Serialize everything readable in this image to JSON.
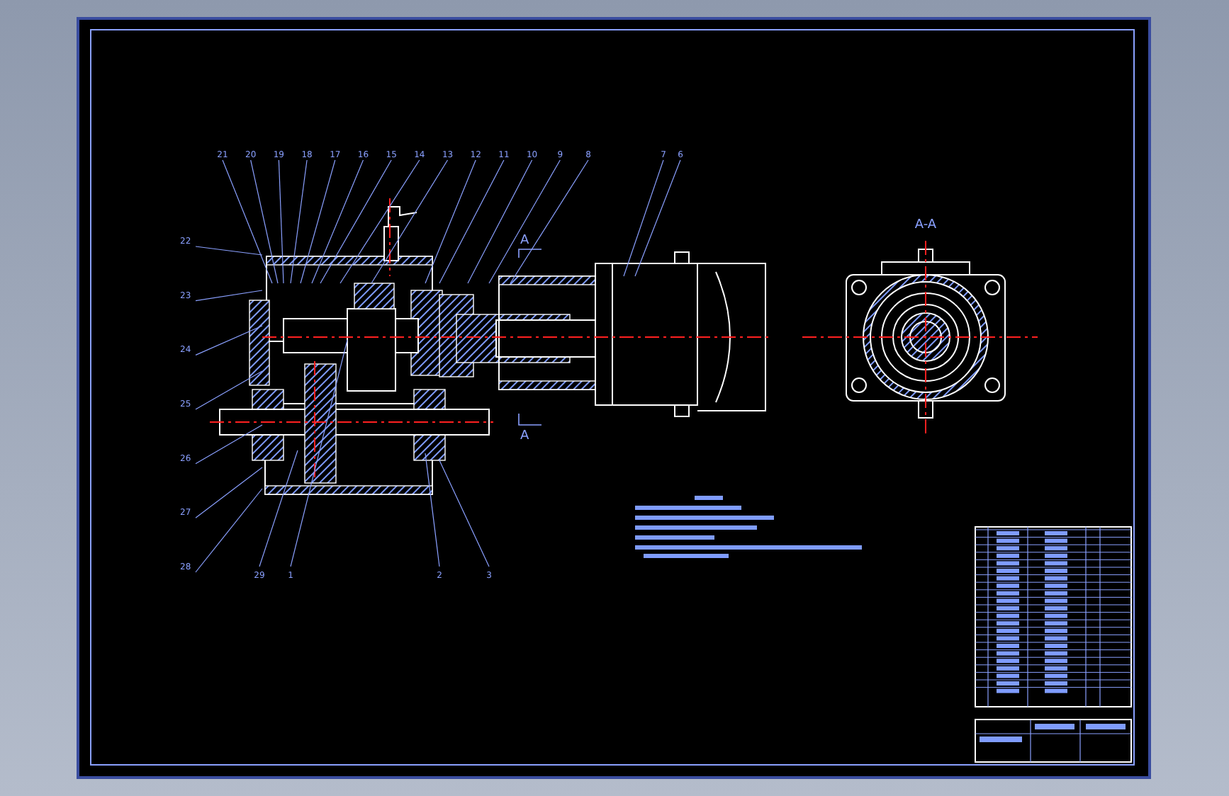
{
  "top_callouts": [
    "21",
    "20",
    "19",
    "18",
    "17",
    "16",
    "15",
    "14",
    "13",
    "12",
    "11",
    "10",
    "9",
    "8"
  ],
  "motor_callouts": [
    "7",
    "6"
  ],
  "left_callouts": [
    "22",
    "23",
    "24",
    "25",
    "26",
    "27",
    "28"
  ],
  "bottom_callouts": [
    "29",
    "1",
    "2",
    "3"
  ],
  "section_marks": [
    "A",
    "A"
  ],
  "section_view": {
    "title": "A-A"
  }
}
